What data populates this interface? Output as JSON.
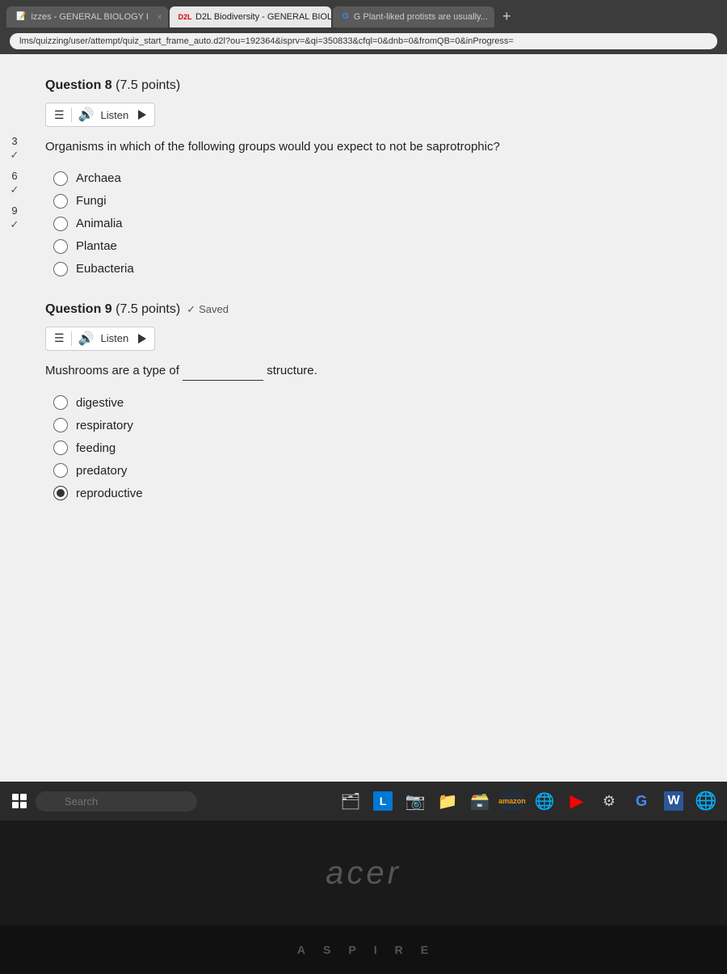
{
  "browser": {
    "tabs": [
      {
        "id": "tab1",
        "label": "izzes - GENERAL BIOLOGY I",
        "active": false,
        "favicon": "📝"
      },
      {
        "id": "tab2",
        "label": "D2L Biodiversity - GENERAL BIOLO...",
        "active": true,
        "favicon": "D2L"
      },
      {
        "id": "tab3",
        "label": "G Plant-liked protists are usually...",
        "active": false,
        "favicon": "G"
      }
    ],
    "address": "lms/quizzing/user/attempt/quiz_start_frame_auto.d2l?ou=192364&isprv=&qi=350833&cfql=0&dnb=0&fromQB=0&inProgress="
  },
  "sidebar": {
    "items": [
      {
        "number": "3",
        "check": "✓"
      },
      {
        "number": "6",
        "check": "✓"
      },
      {
        "number": "9",
        "check": "✓"
      }
    ]
  },
  "questions": [
    {
      "id": "q8",
      "title": "Question 8",
      "points": "(7.5 points)",
      "saved": false,
      "text": "Organisms in which of the following groups would you expect to not be saprotrophic?",
      "options": [
        {
          "label": "Archaea",
          "selected": false
        },
        {
          "label": "Fungi",
          "selected": false
        },
        {
          "label": "Animalia",
          "selected": false
        },
        {
          "label": "Plantae",
          "selected": false
        },
        {
          "label": "Eubacteria",
          "selected": false
        }
      ]
    },
    {
      "id": "q9",
      "title": "Question 9",
      "points": "(7.5 points)",
      "saved": true,
      "saved_label": "Saved",
      "text_before": "Mushrooms are a type of",
      "text_after": "structure.",
      "options": [
        {
          "label": "digestive",
          "selected": false
        },
        {
          "label": "respiratory",
          "selected": false
        },
        {
          "label": "feeding",
          "selected": false
        },
        {
          "label": "predatory",
          "selected": false
        },
        {
          "label": "reproductive",
          "selected": true
        }
      ]
    }
  ],
  "listen_label": "Listen",
  "taskbar": {
    "search_placeholder": "Search",
    "icons": [
      "📁",
      "📄",
      "🎥",
      "📁",
      "🌐",
      "▶",
      "🔧",
      "G",
      "W",
      "G"
    ]
  },
  "acer_logo": "acer",
  "keyboard_letters": [
    "A",
    "S",
    "P",
    "I",
    "R",
    "E"
  ]
}
